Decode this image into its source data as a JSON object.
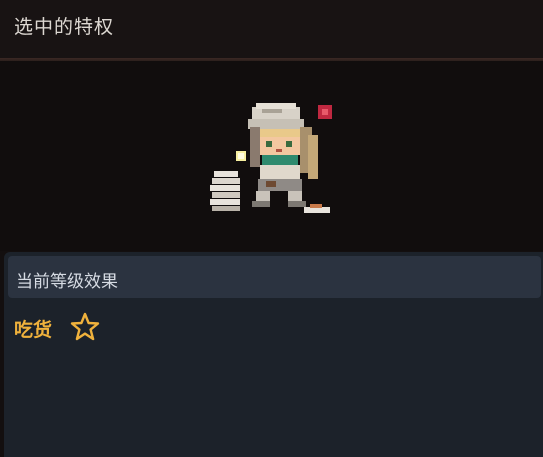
{
  "header": {
    "title": "选中的特权"
  },
  "effect_panel": {
    "title": "当前等级效果",
    "perk_name": "吃货",
    "perk_icon": "star-outline-icon",
    "perk_color": "#f0b23c"
  },
  "preview": {
    "sprite": "pixel-character-with-plates"
  },
  "colors": {
    "background": "#130f0f",
    "divider": "#3c2824",
    "panel": "#1c222a",
    "panel_header": "#2b3340",
    "accent": "#f0b23c"
  }
}
